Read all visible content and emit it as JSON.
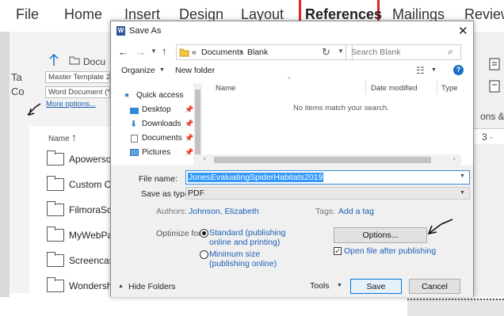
{
  "ribbon": {
    "tabs": [
      "File",
      "Home",
      "Insert",
      "Design",
      "Layout",
      "References",
      "Mailings",
      "Review"
    ]
  },
  "background": {
    "left_fragments": [
      "Ta",
      "Co"
    ],
    "docu_label": "Docu",
    "field1": "Master Template 20",
    "field2": "Word Document (*.",
    "more_options": "More options...",
    "name_header": "Name",
    "items": [
      "Apowerso",
      "Custom O",
      "FilmoraScr",
      "MyWebPag",
      "Screencast",
      "Wondersh"
    ],
    "right_fragment_1": "ons &",
    "right_fragment_2": "3 ·"
  },
  "dialog": {
    "title": "Save As",
    "breadcrumb": [
      "«",
      "Documents",
      "Blank"
    ],
    "search_placeholder": "Search Blank",
    "toolbar": {
      "organize": "Organize",
      "new_folder": "New folder"
    },
    "nav_items": [
      "Quick access",
      "Desktop",
      "Downloads",
      "Documents",
      "Pictures"
    ],
    "columns": [
      "Name",
      "Date modified",
      "Type"
    ],
    "empty_message": "No items match your search.",
    "file_name_label": "File name:",
    "file_name_value": "JonesEvaluatingSpiderHabitats2019",
    "save_type_label": "Save as type:",
    "save_type_value": "PDF",
    "authors_label": "Authors:",
    "authors_value": "Johnson, Elizabeth",
    "tags_label": "Tags:",
    "tags_value": "Add a tag",
    "optimize_label": "Optimize for:",
    "opt_standard": "Standard (publishing online and printing)",
    "opt_standard_1": "Standard (publishing",
    "opt_standard_2": "online and printing)",
    "opt_min_1": "Minimum size",
    "opt_min_2": "(publishing online)",
    "options_button": "Options...",
    "open_after": "Open file after publishing",
    "hide_folders": "Hide Folders",
    "tools": "Tools",
    "save": "Save",
    "cancel": "Cancel"
  },
  "colors": {
    "accent": "#1a5fb4",
    "highlight": "#e0242b",
    "selection": "#3399ff"
  }
}
